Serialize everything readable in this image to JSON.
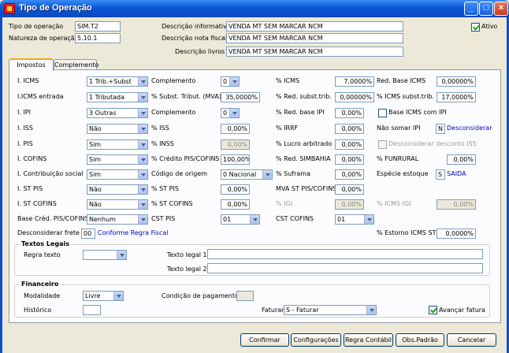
{
  "window": {
    "title": "Tipo de Operação"
  },
  "header": {
    "tipo_operacao_label": "Tipo de operação",
    "tipo_operacao_value": "SIM.T2",
    "natureza_label": "Natureza de operação",
    "natureza_value": "5.10.1",
    "desc_informativa_label": "Descrição informativa",
    "desc_informativa_value": "VENDA MT SEM MARCAR NCM",
    "desc_nota_label": "Descrição nota fiscal",
    "desc_nota_value": "VENDA MT SEM MARCAR NCM",
    "desc_livros_label": "Descrição livros",
    "desc_livros_value": "VENDA MT SEM MARCAR NCM",
    "ativo_label": "Ativo"
  },
  "tabs": [
    "Impostos",
    "Complemento"
  ],
  "impostos": {
    "icms_label": "I. ICMS",
    "icms_value": "1 Trib.+Subst",
    "complemento1_label": "Complemento",
    "complemento1_value": "0",
    "pct_icms_label": "% ICMS",
    "pct_icms_value": "7,0000%",
    "red_base_icms_label": "Red. Base ICMS",
    "red_base_icms_value": "0,00000%",
    "icms_entrada_label": "I.ICMS entrada",
    "icms_entrada_value": "1 Tributada",
    "subst_tribut_label": "% Subst. Tribut. (MVA)",
    "subst_tribut_value": "35,0000%",
    "red_subst_trib_label": "% Red. subst.trib.",
    "red_subst_trib_value": "0,00000%",
    "icms_subst_trib_label": "% ICMS subst.trib.",
    "icms_subst_trib_value": "17,0000%",
    "ipi_label": "I. IPI",
    "ipi_value": "3 Outras",
    "complemento2_label": "Complemento",
    "complemento2_value": "0",
    "red_base_ipi_label": "% Red. base IPI",
    "red_base_ipi_value": "0,00%",
    "base_icms_ipi_label": "Base ICMS com IPI",
    "iss_label": "I. ISS",
    "iss_value": "Não",
    "pct_iss_label": "% ISS",
    "pct_iss_value": "0,00%",
    "irrf_label": "% IRRF",
    "irrf_value": "0,00%",
    "nao_somar_ipi_label": "Não somar IPI",
    "nao_somar_ipi_value": "N",
    "nao_somar_ipi_desc": "Desconsiderar",
    "pis_label": "I. PIS",
    "pis_value": "Sim",
    "inss_label": "% INSS",
    "inss_value": "0,00%",
    "lucro_label": "% Lucro arbitrado",
    "lucro_value": "0,00%",
    "desconsiderar_iss_label": "Desconsiderar desconto ISS",
    "cofins_label": "I. COFINS",
    "cofins_value": "Sim",
    "credito_label": "% Crédito PIS/COFINS",
    "credito_value": "100,00%",
    "simbahia_label": "% Red. SIMBAHIA",
    "simbahia_value": "0,00%",
    "funrural_label": "% FUNRURAL",
    "funrural_value": "0,00%",
    "contrib_label": "I. Contribuição social",
    "contrib_value": "Sim",
    "origem_label": "Código de origem",
    "origem_value": "0 Nacional",
    "suframa_label": "% Suframa",
    "suframa_value": "0,00%",
    "especie_label": "Espécie estoque",
    "especie_value": "S",
    "especie_desc": "SAIDA",
    "st_pis_label": "I. ST PIS",
    "st_pis_value": "Não",
    "pct_st_pis_label": "% ST PIS",
    "pct_st_pis_value": "0,00%",
    "mva_st_label": "MVA ST PIS/COFINS",
    "mva_st_value": "0,00%",
    "st_cofins_label": "I. ST COFINS",
    "st_cofins_value": "Não",
    "pct_st_cofins_label": "% ST COFINS",
    "pct_st_cofins_value": "0,00%",
    "igi_label": "% IGI",
    "igi_value": "0,00%",
    "icms_igi_label": "% ICMS IGI",
    "icms_igi_value": "0,00%",
    "base_cred_label": "Base Créd. PIS/COFINS",
    "base_cred_value": "Nenhum",
    "cst_pis_label": "CST PIS",
    "cst_pis_value": "01",
    "cst_cofins_label": "CST COFINS",
    "cst_cofins_value": "01",
    "desc_frete_label": "Desconsiderar frete",
    "desc_frete_value": "00",
    "desc_frete_desc": "Conforme Regra Fiscal",
    "estorno_label": "% Estorno ICMS ST",
    "estorno_value": "0,0000%"
  },
  "textos_legais": {
    "title": "Textos Legais",
    "regra_label": "Regra texto",
    "regra_value": "",
    "texto1_label": "Texto legal 1",
    "texto1_value": "",
    "texto2_label": "Texto legal 2",
    "texto2_value": ""
  },
  "financeiro": {
    "title": "Financeiro",
    "modalidade_label": "Modalidade",
    "modalidade_value": "Livre",
    "condicao_label": "Condição de pagamento",
    "condicao_value": "",
    "historico_label": "Histórico",
    "historico_value": "",
    "faturar_label": "Faturar",
    "faturar_value": "S - Faturar",
    "avancar_label": "Avançar fatura"
  },
  "buttons": [
    "Confirmar",
    "Configurações",
    "Regra Contábil",
    "Obs.Padrão",
    "Cancelar"
  ],
  "colors": {
    "titlebar": "#0a56d8",
    "link": "#0000c0",
    "focus_tab": "#f5a623"
  }
}
